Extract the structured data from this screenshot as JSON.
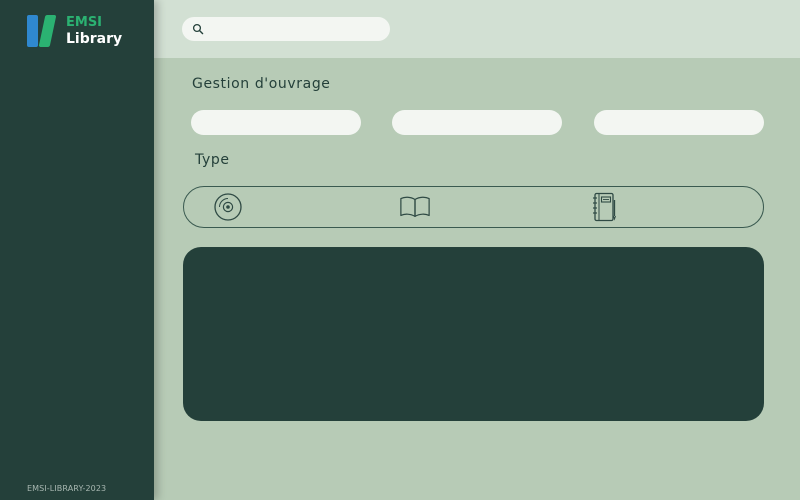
{
  "app": {
    "logo_line1": "EMSI",
    "logo_line2": "Library",
    "footer": "EMSI-LIBRARY-2023"
  },
  "colors": {
    "sidebar": "#24403a",
    "header": "#d2e0d3",
    "main_bg": "#b7cbb6",
    "field": "#f3f6f2",
    "logo_blue": "#2f88cf",
    "logo_green": "#2bb272"
  },
  "search": {
    "icon": "search-icon",
    "value": "",
    "placeholder": ""
  },
  "main": {
    "title": "Gestion d'ouvrage",
    "fields": [
      {
        "value": "",
        "placeholder": ""
      },
      {
        "value": "",
        "placeholder": ""
      },
      {
        "value": "",
        "placeholder": ""
      }
    ],
    "type_label": "Type",
    "types": [
      {
        "icon": "cd-icon"
      },
      {
        "icon": "book-icon"
      },
      {
        "icon": "notebook-icon"
      }
    ]
  }
}
